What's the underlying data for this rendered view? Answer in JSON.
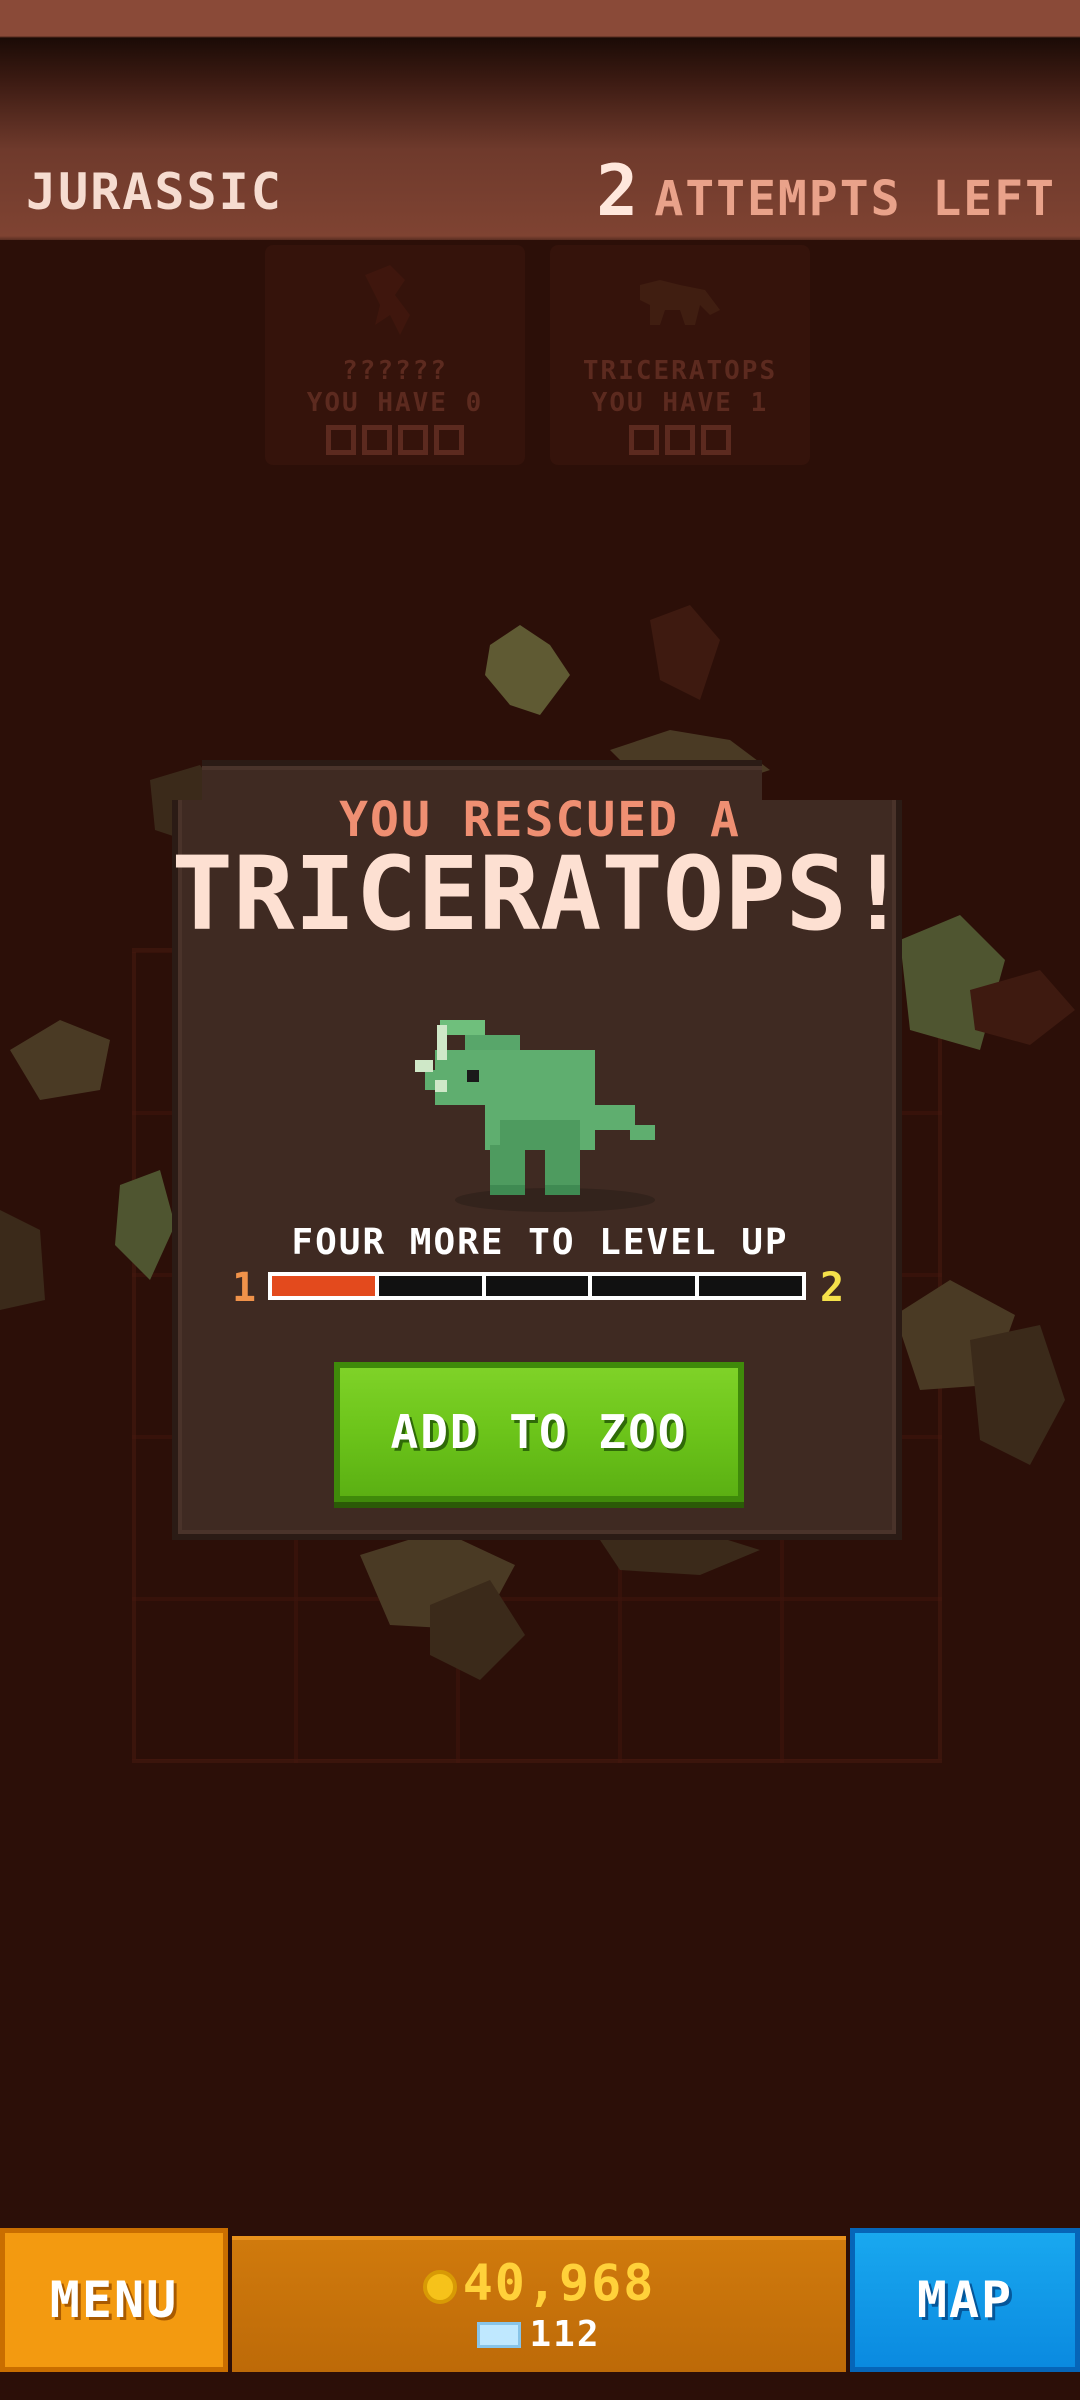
{
  "header": {
    "era": "JURASSIC",
    "attempts_count": "2",
    "attempts_label": "ATTEMPTS LEFT"
  },
  "background_cards": [
    {
      "name": "??????",
      "owned": "YOU HAVE 0",
      "slots": 4
    },
    {
      "name": "TRICERATOPS",
      "owned": "YOU HAVE 1",
      "slots": 3
    }
  ],
  "modal": {
    "subtitle": "YOU RESCUED A",
    "title": "TRICERATOPS!",
    "dino_icon": "triceratops-pixel-sprite",
    "level_text": "FOUR MORE TO LEVEL UP",
    "level_from": "1",
    "level_to": "2",
    "progress_segments": 5,
    "progress_filled": 1,
    "button_label": "ADD TO ZOO"
  },
  "bottom_bar": {
    "menu_label": "MENU",
    "coins": "40,968",
    "gems": "112",
    "map_label": "MAP"
  },
  "colors": {
    "background": "#2c0f08",
    "accent_orange": "#f39a10",
    "accent_green": "#6cc41a",
    "accent_blue": "#0a8ae0",
    "progress_fill": "#e34a1d"
  }
}
